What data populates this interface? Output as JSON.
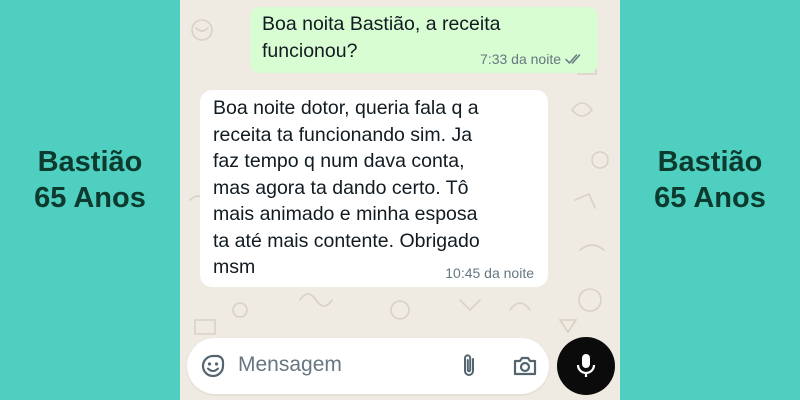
{
  "labels": {
    "left": {
      "line1": "Bastião",
      "line2": "65 Anos"
    },
    "right": {
      "line1": "Bastião",
      "line2": "65 Anos"
    }
  },
  "chat": {
    "messages": [
      {
        "direction": "outgoing",
        "text": "Boa noita Bastião, a receita\nfuncionou?",
        "time": "7:33 da noite",
        "status_icon": "double-check-icon"
      },
      {
        "direction": "incoming",
        "text": "Boa noite dotor, queria fala q a\nreceita ta funcionando sim. Ja\nfaz tempo q num dava conta,\nmas agora ta dando certo. Tô\nmais animado e minha esposa\nta até mais contente. Obrigado\nmsm",
        "time": "10:45 da noite"
      }
    ],
    "input": {
      "placeholder": "Mensagem",
      "icons": [
        "emoji-icon",
        "paperclip-icon",
        "camera-icon",
        "microphone-icon"
      ]
    }
  },
  "colors": {
    "background": "#4ecfbf",
    "label_text": "#0d3a2e",
    "chat_background": "#efeae2",
    "outgoing_bubble": "#d9fdd3",
    "incoming_bubble": "#ffffff",
    "send_button": "#0b0b0b"
  }
}
